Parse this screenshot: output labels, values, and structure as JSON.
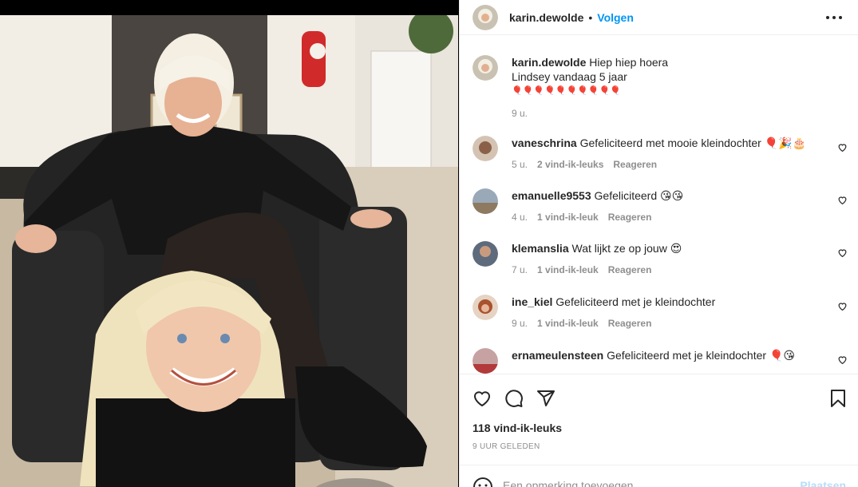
{
  "post": {
    "username": "karin.dewolde",
    "separator": "•",
    "follow_label": "Volgen"
  },
  "caption": {
    "username": "karin.dewolde",
    "text": "Hiep hiep hoera",
    "line2": "Lindsey vandaag 5 jaar",
    "line3": "🎈🎈🎈🎈🎈🎈🎈🎈🎈🎈",
    "time": "9 u."
  },
  "comments": [
    {
      "username": "vaneschrina",
      "text": "Gefeliciteerd met mooie kleindochter 🎈🎉🎂",
      "time": "5 u.",
      "likes": "2 vind-ik-leuks",
      "reply": "Reageren"
    },
    {
      "username": "emanuelle9553",
      "text": "Gefeliciteerd 😘😘",
      "time": "4 u.",
      "likes": "1 vind-ik-leuk",
      "reply": "Reageren"
    },
    {
      "username": "klemanslia",
      "text": "Wat lijkt ze op jouw 😍",
      "time": "7 u.",
      "likes": "1 vind-ik-leuk",
      "reply": "Reageren"
    },
    {
      "username": "ine_kiel",
      "text": "Gefeliciteerd met je kleindochter",
      "time": "9 u.",
      "likes": "1 vind-ik-leuk",
      "reply": "Reageren"
    },
    {
      "username": "ernameulensteen",
      "text": "Gefeliciteerd met je kleindochter 🎈😘",
      "time": "",
      "likes": "",
      "reply": ""
    }
  ],
  "actions": {
    "like_count": "118 vind-ik-leuks",
    "posted_ago": "9 UUR GELEDEN"
  },
  "add_comment": {
    "placeholder": "Een opmerking toevoegen...",
    "post_label": "Plaatsen"
  },
  "colors": {
    "accent": "#0095f6",
    "muted": "#8e8e8e",
    "text": "#262626",
    "post_disabled": "#b2dffc"
  },
  "icons": [
    "more-options-icon",
    "heart-icon",
    "comment-icon",
    "share-icon",
    "bookmark-icon",
    "emoji-icon"
  ]
}
